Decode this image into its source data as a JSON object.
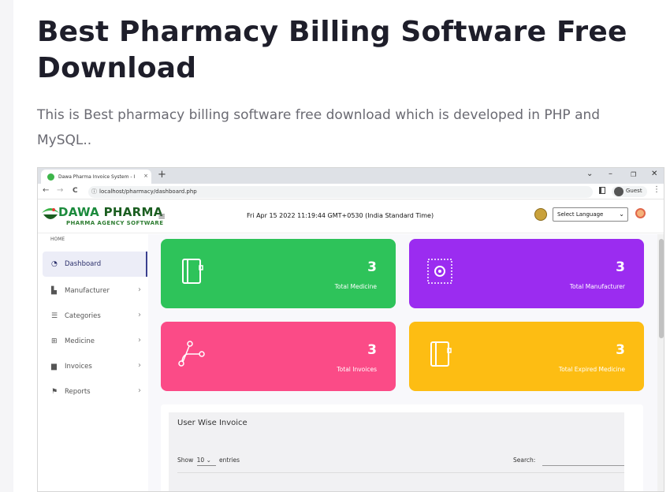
{
  "article": {
    "title": "Best Pharmacy Billing Software Free Download",
    "description": "This is Best pharmacy billing software free download which is developed in PHP and MySQL.."
  },
  "browser": {
    "tab_title": "Dawa Pharma Invoice System - I",
    "tab_close": "×",
    "new_tab": "+",
    "url": "localhost/pharmacy/dashboard.php",
    "profile": "Guest",
    "controls": {
      "dropdown": "⌄",
      "minimize": "–",
      "restore": "❐",
      "close": "✕"
    },
    "nav": {
      "back": "←",
      "forward": "→",
      "reload": "C"
    }
  },
  "app": {
    "logo_title_1": "DAWA",
    "logo_title_2": "PHARMA",
    "logo_subtitle": "PHARMA AGENCY SOFTWARE",
    "datetime": "Fri Apr 15 2022 11:19:44 GMT+0530 (India Standard Time)",
    "language_select": "Select Language",
    "home_label": "HOME",
    "menu": [
      {
        "label": "Dashboard",
        "icon": "dashboard-icon",
        "active": true
      },
      {
        "label": "Manufacturer",
        "icon": "factory-icon"
      },
      {
        "label": "Categories",
        "icon": "list-icon"
      },
      {
        "label": "Medicine",
        "icon": "medkit-icon"
      },
      {
        "label": "Invoices",
        "icon": "file-icon"
      },
      {
        "label": "Reports",
        "icon": "flag-icon"
      }
    ],
    "cards": [
      {
        "value": "3",
        "label": "Total Medicine",
        "color": "#2ec35a",
        "icon": "notebook-icon"
      },
      {
        "value": "3",
        "label": "Total Manufacturer",
        "color": "#9b2cf0",
        "icon": "gear-icon"
      },
      {
        "value": "3",
        "label": "Total Invoices",
        "color": "#fb4b87",
        "icon": "vector-path-icon"
      },
      {
        "value": "3",
        "label": "Total Expired Medicine",
        "color": "#fdbd13",
        "icon": "notebook-icon"
      }
    ],
    "panel": {
      "title": "User Wise Invoice",
      "show_label": "Show",
      "show_value": "10",
      "entries_label": "entries",
      "search_label": "Search:"
    }
  }
}
